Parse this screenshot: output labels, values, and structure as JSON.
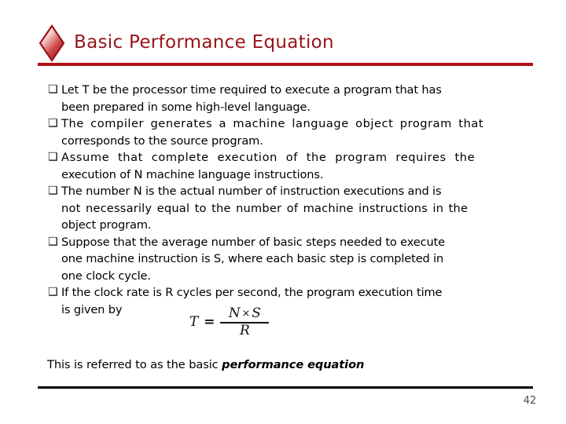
{
  "slide": {
    "background_color": "#FFFFFF",
    "title": "Basic Performance Equation",
    "title_color": "#961418",
    "rule_color": "#B01116",
    "bullet_marker": "❑",
    "diamond_icon": "diamond-bullet-icon"
  },
  "bullets": [
    {
      "marker": "❑",
      "lines": [
        "Let T be the processor time required to execute a program that has",
        "been prepared in some high-level language."
      ],
      "text": "Let T be the processor time required to execute a program that has been prepared in some high-level language."
    },
    {
      "marker": "❑",
      "lines": [
        "The compiler generates a machine language object program that",
        "corresponds to the source program."
      ],
      "text": "The compiler generates a machine language object program that corresponds to the source program."
    },
    {
      "marker": "❑",
      "lines": [
        "Assume that complete execution of the program requires the",
        "execution of N machine language instructions."
      ],
      "text": "Assume that complete execution of the program requires the execution of N machine language instructions."
    },
    {
      "marker": "❑",
      "lines": [
        "The number N is the actual number of instruction executions and is",
        "not necessarily equal to the number of machine instructions in the",
        "object program."
      ],
      "text": "The number N is the actual number of instruction executions and is not necessarily equal to the number of machine instructions in the object program."
    },
    {
      "marker": "❑",
      "lines": [
        "Suppose that the average number of basic steps needed to execute",
        "one machine instruction is S, where each basic step is completed in",
        "one clock cycle."
      ],
      "text": "Suppose that the average number of basic steps needed to execute one machine instruction is S, where each basic step is completed in one clock cycle."
    },
    {
      "marker": "❑",
      "lines": [
        "If the clock rate is R cycles per second, the program execution time",
        "is given by"
      ],
      "text": "If the clock rate is R cycles per second, the program execution time is given by"
    }
  ],
  "equation": {
    "lhs": "T",
    "relation": "=",
    "numerator_left": "N",
    "numerator_operator": "×",
    "numerator_right": "S",
    "denominator": "R",
    "plain": "T = N × S / R"
  },
  "closing": {
    "lead": "This is referred to as the basic ",
    "emphasis": "performance equation"
  },
  "footer": {
    "page_number": "42",
    "rule_color": "#000000"
  }
}
